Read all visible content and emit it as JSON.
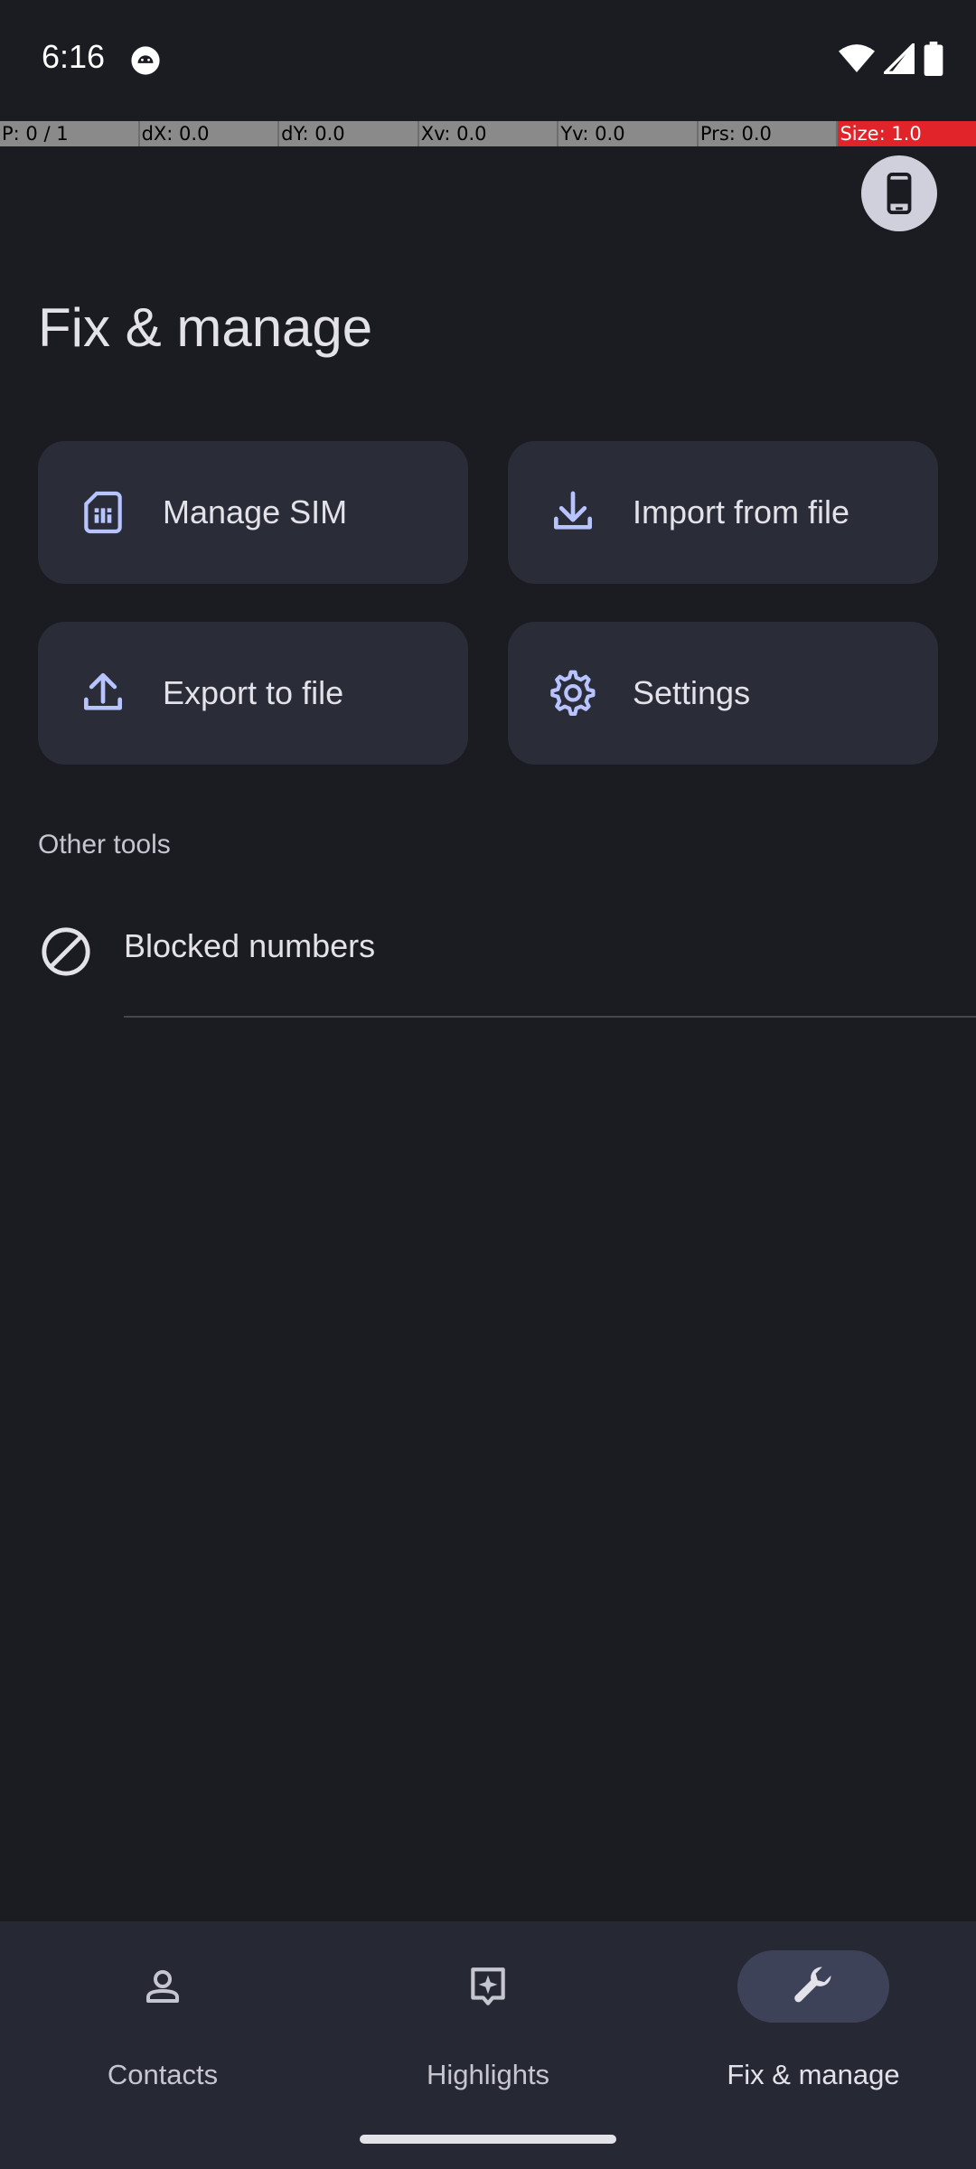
{
  "status_bar": {
    "time": "6:16"
  },
  "debug_overlay": {
    "cells": [
      "P: 0 / 1",
      "dX: 0.0",
      "dY: 0.0",
      "Xv: 0.0",
      "Yv: 0.0",
      "Prs: 0.0",
      "Size: 1.0"
    ]
  },
  "page": {
    "title": "Fix & manage"
  },
  "tiles": [
    {
      "label": "Manage SIM",
      "icon": "sim-card-icon"
    },
    {
      "label": "Import from file",
      "icon": "download-icon"
    },
    {
      "label": "Export to file",
      "icon": "upload-icon"
    },
    {
      "label": "Settings",
      "icon": "gear-icon"
    }
  ],
  "other_tools": {
    "heading": "Other tools",
    "items": [
      {
        "label": "Blocked numbers",
        "icon": "block-icon"
      }
    ]
  },
  "bottom_nav": {
    "items": [
      {
        "label": "Contacts",
        "icon": "person-icon",
        "active": false
      },
      {
        "label": "Highlights",
        "icon": "sparkle-icon",
        "active": false
      },
      {
        "label": "Fix & manage",
        "icon": "wrench-icon",
        "active": true
      }
    ]
  },
  "colors": {
    "background": "#1b1c21",
    "tile": "#2a2c38",
    "icon_accent": "#b8c4ff",
    "active_pill": "#3d4259",
    "debug_highlight": "#e0242a"
  }
}
